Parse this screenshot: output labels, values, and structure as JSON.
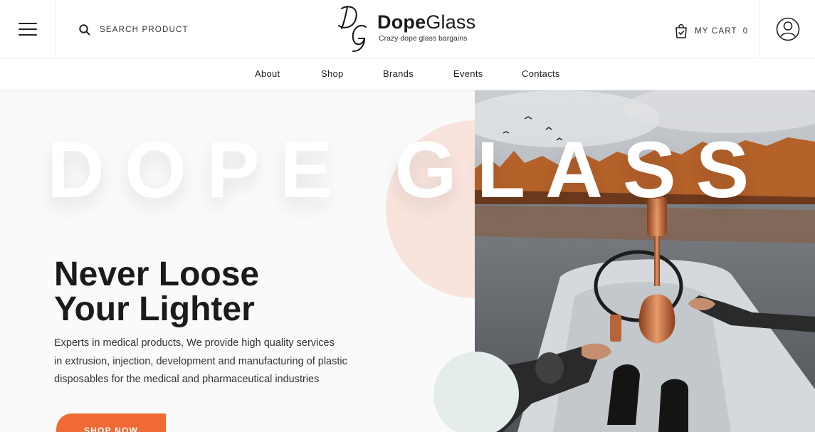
{
  "header": {
    "search_label": "SEARCH PRODUCT",
    "brand_bold": "Dope",
    "brand_light": "Glass",
    "tagline": "Crazy dope glass bargains",
    "monogram": "DG",
    "cart_label": "MY CART",
    "cart_count": "0"
  },
  "nav": {
    "items": [
      "About",
      "Shop",
      "Brands",
      "Events",
      "Contacts"
    ]
  },
  "hero": {
    "big_word": "DOPE GLASS",
    "headline_line1": "Never Loose",
    "headline_line2": "Your Lighter",
    "description_line1": "Experts in medical products, We provide high quality services",
    "description_line2": "in extrusion, injection, development and manufacturing of plastic",
    "description_line3": "disposables for the medical and pharmaceutical industries",
    "cta_label": "SHOP NOW"
  },
  "colors": {
    "accent": "#ef6a35",
    "peach_circle": "#f8e4dd",
    "blue_circle": "#e4ecec",
    "text_dark": "#1b1b1b"
  },
  "icons": [
    "menu-icon",
    "search-icon",
    "cart-icon",
    "user-icon"
  ]
}
